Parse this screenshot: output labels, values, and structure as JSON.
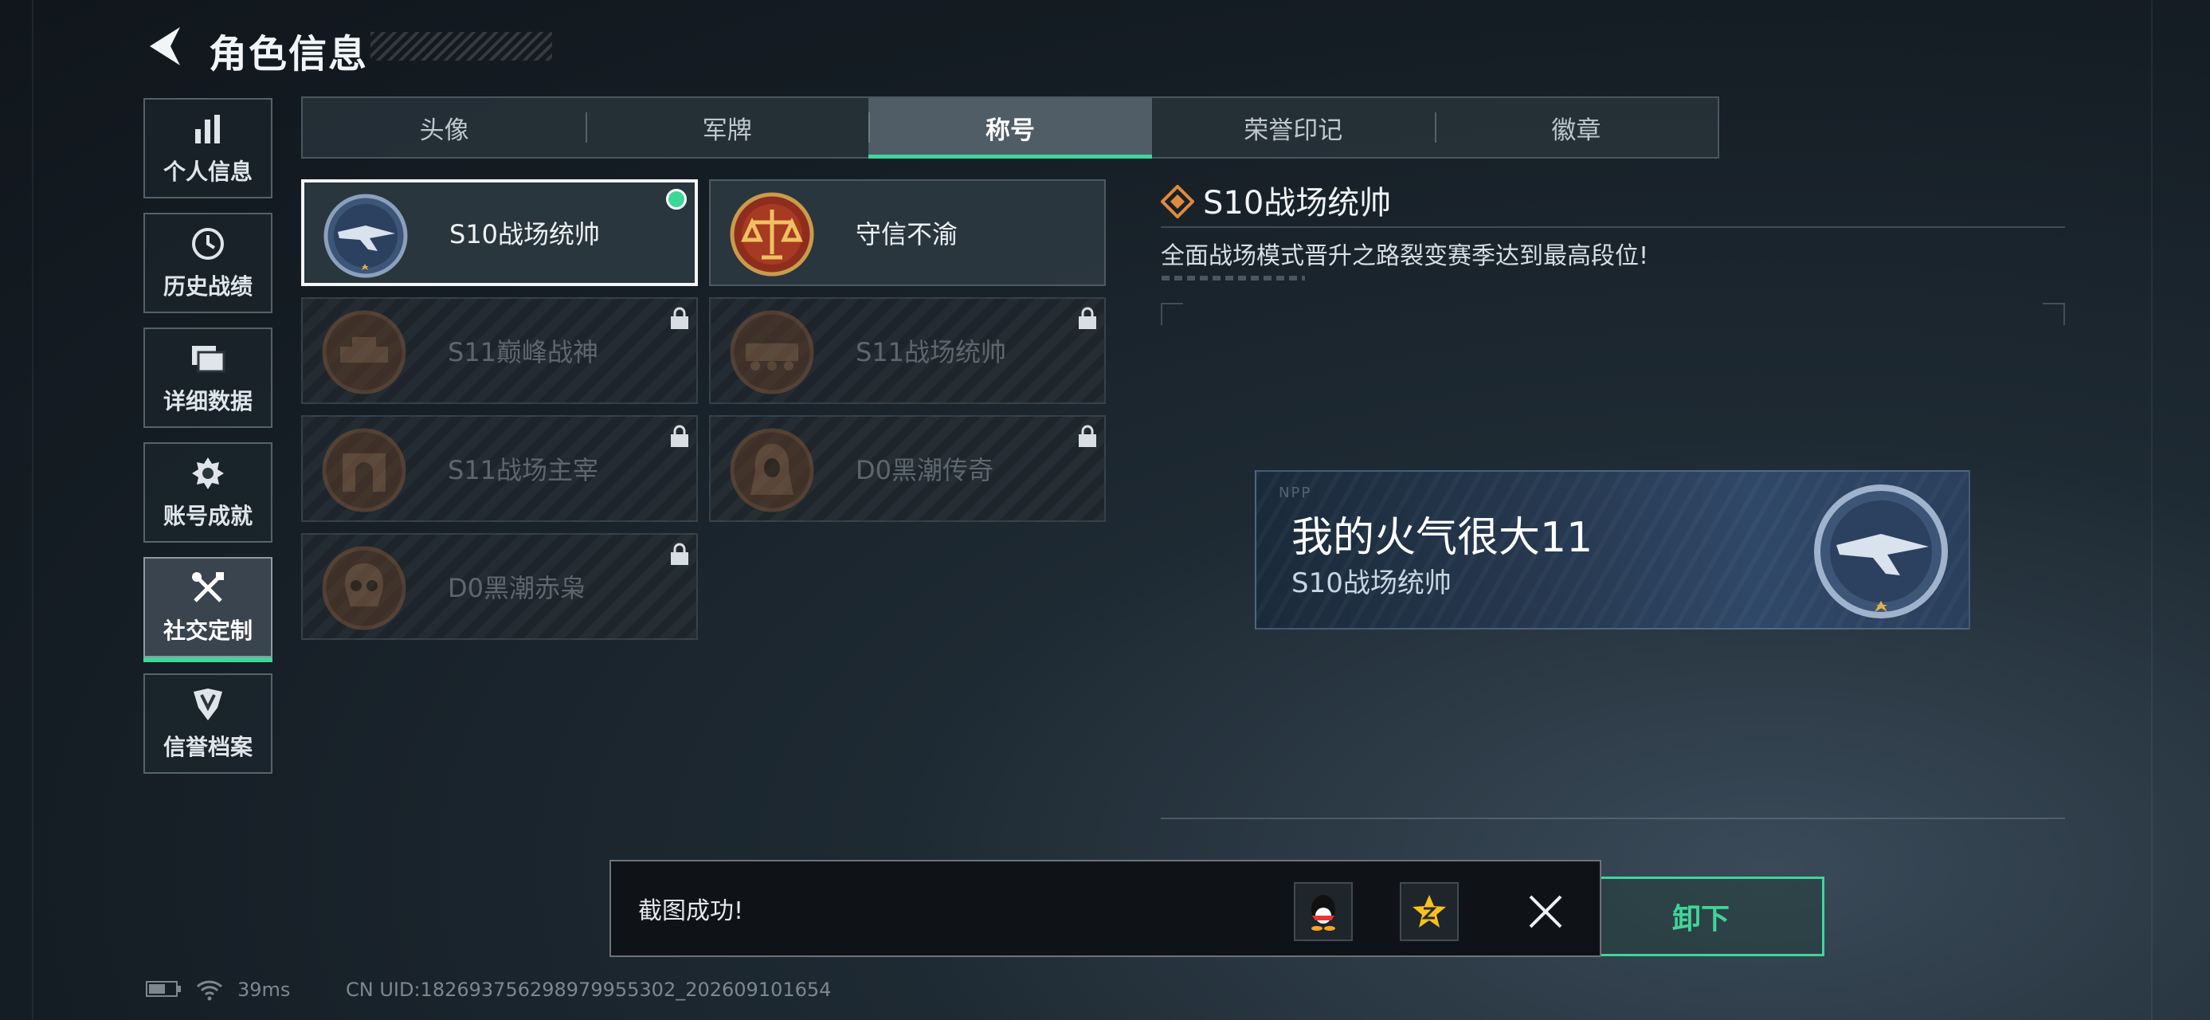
{
  "header": {
    "title": "角色信息"
  },
  "sidebar": {
    "items": [
      {
        "label": "个人信息",
        "icon": "bar-chart-icon",
        "active": false
      },
      {
        "label": "历史战绩",
        "icon": "clock-icon",
        "active": false
      },
      {
        "label": "详细数据",
        "icon": "folder-icon",
        "active": false
      },
      {
        "label": "账号成就",
        "icon": "achievement-icon",
        "active": false
      },
      {
        "label": "社交定制",
        "icon": "tools-icon",
        "active": true
      },
      {
        "label": "信誉档案",
        "icon": "credit-shield-icon",
        "active": false
      }
    ]
  },
  "tabs": [
    {
      "label": "头像",
      "active": false
    },
    {
      "label": "军牌",
      "active": false
    },
    {
      "label": "称号",
      "active": true
    },
    {
      "label": "荣誉印记",
      "active": false
    },
    {
      "label": "徽章",
      "active": false
    }
  ],
  "titles": [
    {
      "name": "S10战场统帅",
      "locked": false,
      "selected": true,
      "equipped": true,
      "medal": "aircraft-medal-icon"
    },
    {
      "name": "守信不渝",
      "locked": false,
      "selected": false,
      "equipped": false,
      "medal": "scales-medal-icon"
    },
    {
      "name": "S11巅峰战神",
      "locked": true,
      "medal": "tank-medal-icon"
    },
    {
      "name": "S11战场统帅",
      "locked": true,
      "medal": "apc-medal-icon"
    },
    {
      "name": "S11战场主宰",
      "locked": true,
      "medal": "arch-medal-icon"
    },
    {
      "name": "D0黑潮传奇",
      "locked": true,
      "medal": "hooded-figure-medal-icon"
    },
    {
      "name": "D0黑潮赤枭",
      "locked": true,
      "medal": "skull-medal-icon"
    }
  ],
  "detail": {
    "title": "S10战场统帅",
    "description": "全面战场模式晋升之路裂变赛季达到最高段位!"
  },
  "nameplate": {
    "player_name": "我的火气很大11",
    "title": "S10战场统帅",
    "logo": "NPP"
  },
  "unequip_button": {
    "label": "卸下"
  },
  "toast": {
    "message": "截图成功!",
    "share_targets": [
      "qq-icon",
      "qzone-icon"
    ],
    "close_icon": "close-icon"
  },
  "status_bar": {
    "ping": "39ms",
    "uid": "CN UID:18269375629897995530​2_202609101654"
  },
  "colors": {
    "accent": "#3fd69a",
    "background": "#151d24"
  }
}
